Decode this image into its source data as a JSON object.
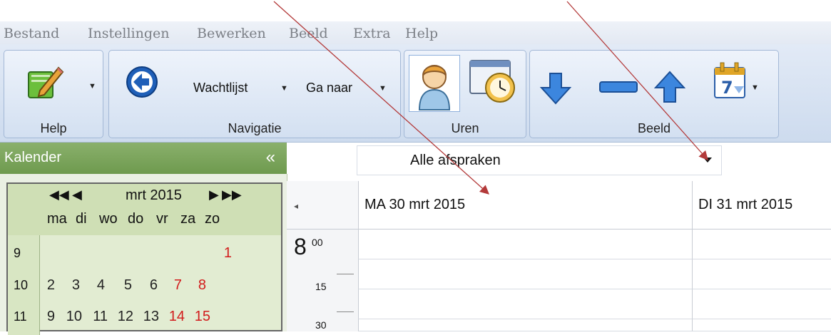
{
  "menu": [
    "Bestand",
    "Instellingen",
    "Bewerken",
    "Beeld",
    "Extra",
    "Help"
  ],
  "ribbon": {
    "help_group": "Help",
    "nav_group": "Navigatie",
    "waitlist": "Wachtlijst",
    "goto": "Ga naar",
    "hours_group": "Uren",
    "view_group": "Beeld"
  },
  "calendar": {
    "title": "Kalender",
    "collapse": "«",
    "month": "mrt 2015",
    "prev_year": "◀◀",
    "prev": "◀",
    "next": "▶",
    "next_year": "▶▶",
    "days": [
      "ma",
      "di",
      "wo",
      "do",
      "vr",
      "za",
      "zo"
    ],
    "weeks": [
      {
        "wk": "9",
        "days": [
          "",
          "",
          "",
          "",
          "",
          "",
          "1"
        ]
      },
      {
        "wk": "10",
        "days": [
          "2",
          "3",
          "4",
          "5",
          "6",
          "7",
          "8"
        ]
      },
      {
        "wk": "11",
        "days": [
          "9",
          "10",
          "11",
          "12",
          "13",
          "14",
          "15"
        ]
      }
    ]
  },
  "filter": {
    "value": "Alle afspraken"
  },
  "grid": {
    "scroll": "◂",
    "columns": [
      "MA  30 mrt 2015",
      "DI  31 mrt 2015"
    ],
    "hour": "8",
    "hour_min": "00",
    "mins": [
      "15",
      "30"
    ]
  },
  "colors": {
    "accent": "#6e9a4e",
    "weekend": "#d21c1c",
    "arrow": "#b33a3a"
  }
}
